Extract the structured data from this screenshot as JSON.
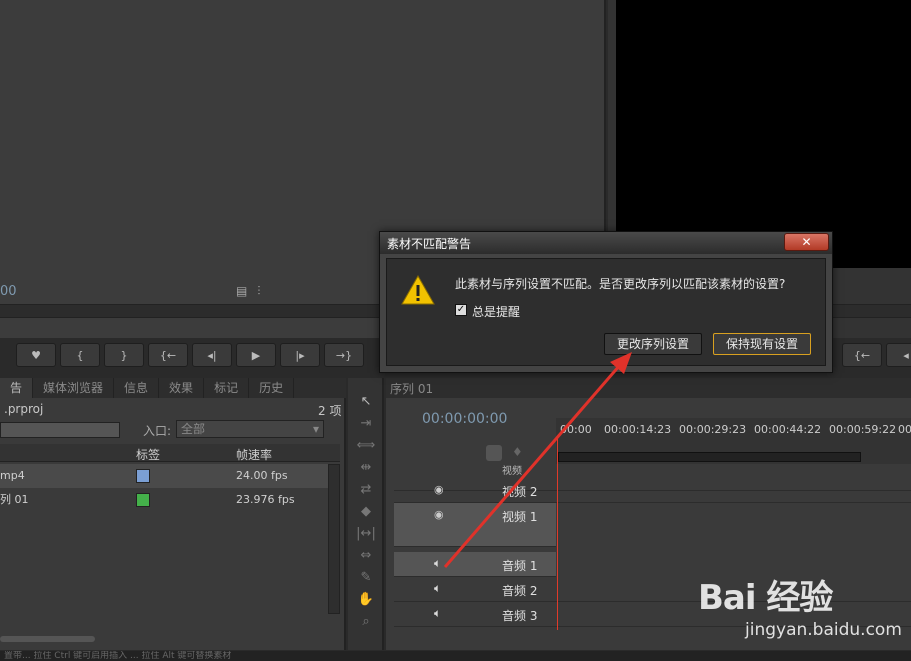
{
  "source_monitor": {
    "timecode": "00",
    "icons": [
      "film-icon",
      "waveform-icon"
    ]
  },
  "transport_left": [
    "marker",
    "in",
    "out",
    "goto-in",
    "step-back",
    "play",
    "step-fwd",
    "goto-out"
  ],
  "project_panel": {
    "tabs": [
      "告",
      "媒体浏览器",
      "信息",
      "效果",
      "标记",
      "历史"
    ],
    "project_file": ".prproj",
    "item_count": "2 项",
    "inpoint_label": "入口:",
    "inpoint_value": "全部",
    "columns": [
      "标签",
      "帧速率"
    ],
    "rows": [
      {
        "name": "mp4",
        "label_color": "#7b9fd4",
        "fps": "24.00 fps"
      },
      {
        "name": "列 01",
        "label_color": "#44b04a",
        "fps": "23.976 fps"
      }
    ]
  },
  "timeline": {
    "tab": "序列 01",
    "timecode": "00:00:00:00",
    "ruler": [
      "00:00",
      "00:00:14:23",
      "00:00:29:23",
      "00:00:44:22",
      "00:00:59:22",
      "00"
    ],
    "tracks": [
      "视频",
      "视频 2",
      "视频 1",
      "音频 1",
      "音频 2",
      "音频 3"
    ]
  },
  "dialog": {
    "title": "素材不匹配警告",
    "close": "✕",
    "message": "此素材与序列设置不匹配。是否更改序列以匹配该素材的设置?",
    "checkbox_label": "总是提醒",
    "checkbox_checked": true,
    "buttons": {
      "change": "更改序列设置",
      "keep": "保持现有设置"
    }
  },
  "watermark": {
    "logo": "Bai 经验",
    "url": "jingyan.baidu.com"
  },
  "status": "置带... 拉住 Ctrl 键可启用插入 ... 拉住 Alt 键可替换素材"
}
